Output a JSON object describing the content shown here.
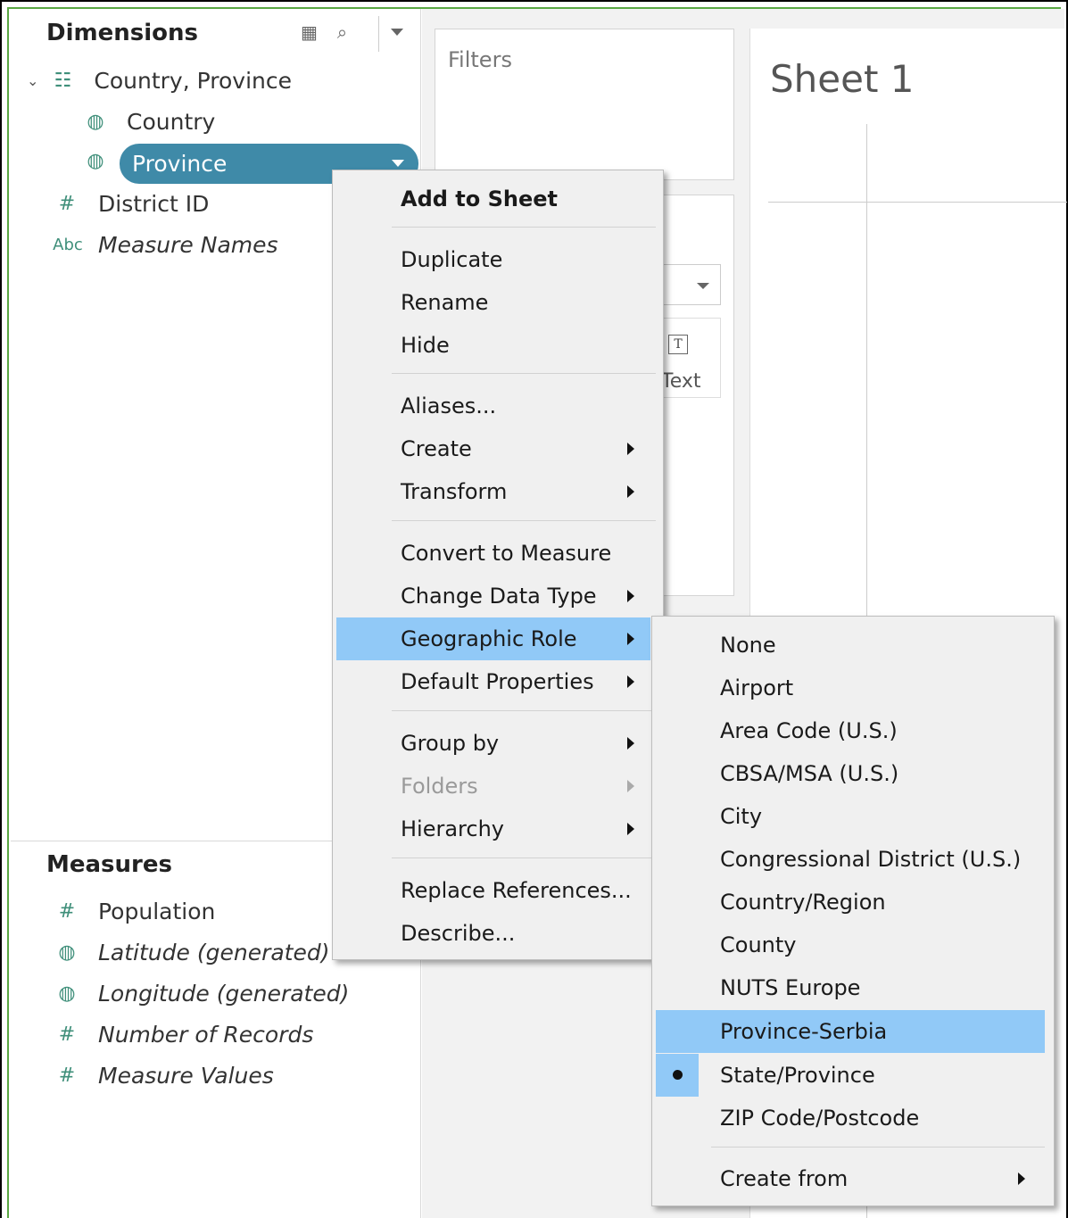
{
  "data_pane": {
    "dimensions_header": "Dimensions",
    "hierarchy_label": "Country, Province",
    "dimensions": [
      {
        "label": "Country",
        "icon": "globe-icon"
      },
      {
        "label": "Province",
        "icon": "globe-icon",
        "selected": true
      },
      {
        "label": "District ID",
        "icon": "hash-icon"
      },
      {
        "label": "Measure Names",
        "icon": "abc-icon",
        "italic": true
      }
    ],
    "measures_header": "Measures",
    "measures": [
      {
        "label": "Population",
        "icon": "hash-icon"
      },
      {
        "label": "Latitude (generated)",
        "icon": "globe-icon",
        "italic": true
      },
      {
        "label": "Longitude (generated)",
        "icon": "globe-icon",
        "italic": true
      },
      {
        "label": "Number of Records",
        "icon": "hash-icon",
        "italic": true
      },
      {
        "label": "Measure Values",
        "icon": "hash-icon",
        "italic": true
      }
    ],
    "icon_glyphs": {
      "globe": "◍",
      "hash": "#",
      "abc": "Abc",
      "hierarchy": "☷",
      "grid": "▦",
      "search": "⌕"
    }
  },
  "shelves": {
    "filters_label": "Filters",
    "marks_text_label": "Text",
    "marks_text_icon": "T"
  },
  "sheet": {
    "title": "Sheet 1"
  },
  "context_menu": {
    "items": [
      {
        "label": "Add to Sheet"
      },
      {
        "label": "Duplicate"
      },
      {
        "label": "Rename"
      },
      {
        "label": "Hide"
      },
      {
        "label": "Aliases..."
      },
      {
        "label": "Create"
      },
      {
        "label": "Transform"
      },
      {
        "label": "Convert to Measure"
      },
      {
        "label": "Change Data Type"
      },
      {
        "label": "Geographic Role"
      },
      {
        "label": "Default Properties"
      },
      {
        "label": "Group by"
      },
      {
        "label": "Folders"
      },
      {
        "label": "Hierarchy"
      },
      {
        "label": "Replace References..."
      },
      {
        "label": "Describe..."
      }
    ]
  },
  "geographic_role_submenu": {
    "items": [
      {
        "label": "None"
      },
      {
        "label": "Airport"
      },
      {
        "label": "Area Code (U.S.)"
      },
      {
        "label": "CBSA/MSA (U.S.)"
      },
      {
        "label": "City"
      },
      {
        "label": "Congressional District (U.S.)"
      },
      {
        "label": "Country/Region"
      },
      {
        "label": "County"
      },
      {
        "label": "NUTS Europe"
      },
      {
        "label": "Province-Serbia"
      },
      {
        "label": "State/Province"
      },
      {
        "label": "ZIP Code/Postcode"
      },
      {
        "label": "Create from"
      }
    ],
    "checked": "State/Province",
    "hovered": "Province-Serbia"
  },
  "colors": {
    "highlight": "#91c9f7",
    "pill": "#3f8aa8",
    "field_icon": "#3f8f7a",
    "border_green": "#5aa844"
  }
}
